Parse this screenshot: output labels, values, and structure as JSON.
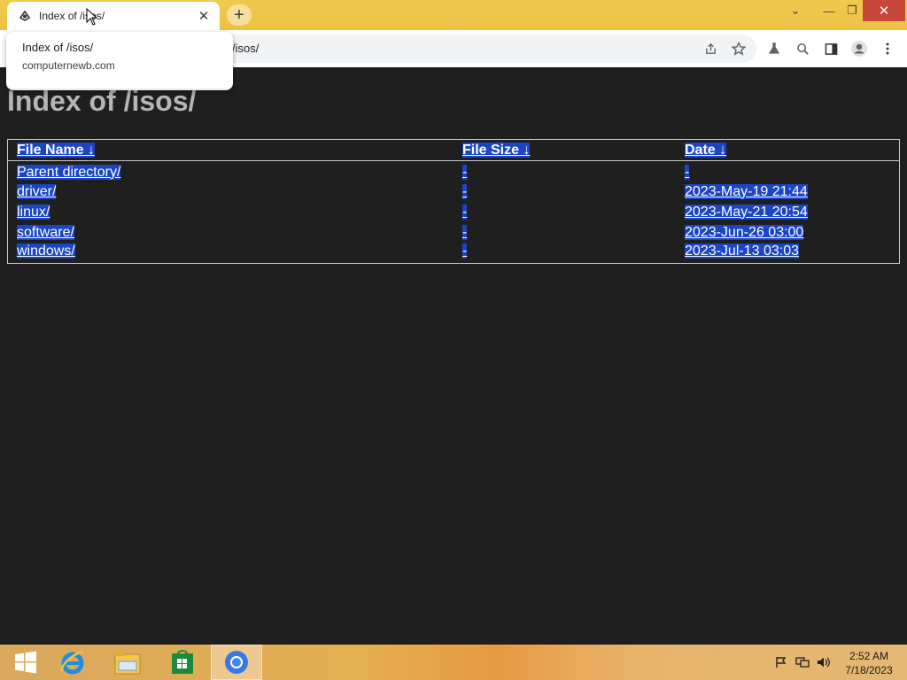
{
  "browser": {
    "tab": {
      "title": "Index of /isos/",
      "close_glyph": "✕"
    },
    "new_tab_glyph": "+",
    "window_controls": {
      "tablist": "⌄",
      "minimize": "—",
      "maximize": "❐",
      "close": "✕"
    },
    "address": {
      "url": "/isos/"
    },
    "hover_card": {
      "title": "Index of /isos/",
      "domain": "computernewb.com"
    }
  },
  "page": {
    "heading": "Index of /isos/",
    "table": {
      "headers": {
        "name": "File Name  ↓ ",
        "size": "File Size  ↓ ",
        "date": "Date  ↓ "
      },
      "rows": [
        {
          "name": "Parent directory/",
          "size": "-",
          "date": "-"
        },
        {
          "name": "driver/",
          "size": "-",
          "date": "2023-May-19 21:44"
        },
        {
          "name": "linux/",
          "size": "-",
          "date": "2023-May-21 20:54"
        },
        {
          "name": "software/",
          "size": "-",
          "date": "2023-Jun-26 03:00"
        },
        {
          "name": "windows/",
          "size": "-",
          "date": "2023-Jul-13 03:03"
        }
      ]
    },
    "colors": {
      "selection": "#1a45c4",
      "background": "#1f1f1f",
      "heading": "#b5b5b5"
    }
  },
  "taskbar": {
    "clock": {
      "time": "2:52 AM",
      "date": "7/18/2023"
    },
    "icons": [
      "windows-start-icon",
      "internet-explorer-icon",
      "file-explorer-icon",
      "store-icon",
      "chrome-icon"
    ],
    "tray_icons": [
      "flag-icon",
      "network-icon",
      "volume-icon"
    ]
  }
}
